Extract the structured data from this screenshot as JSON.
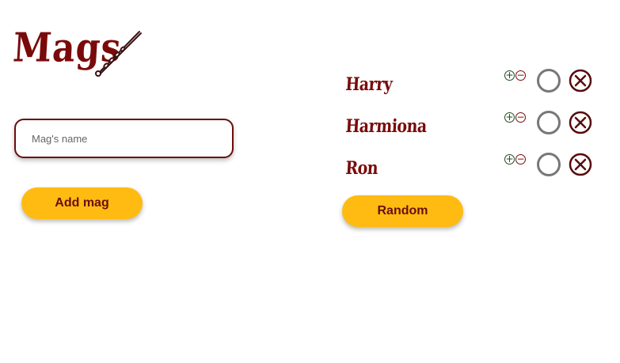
{
  "app": {
    "title": "Mags"
  },
  "form": {
    "name_placeholder": "Mag's name",
    "name_value": "",
    "add_label": "Add mag"
  },
  "mags": [
    {
      "name": "Harry"
    },
    {
      "name": "Harmiona"
    },
    {
      "name": "Ron"
    }
  ],
  "random_label": "Random",
  "icons": {
    "wand": "wand-icon",
    "plus": "plus-circle-icon",
    "minus": "minus-circle-icon",
    "select": "radio-circle-icon",
    "remove": "close-circle-icon"
  },
  "colors": {
    "brand": "#7a0a0a",
    "button": "#ffbb12",
    "plus": "#1f4a1f",
    "radio": "#777777"
  }
}
